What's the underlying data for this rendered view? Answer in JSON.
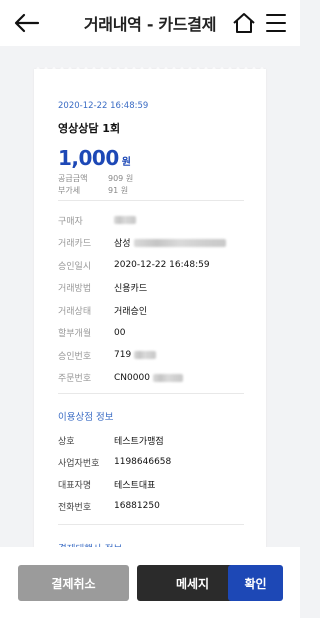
{
  "header": {
    "title": "거래내역 - 카드결제",
    "back_icon": "arrow-left-icon",
    "home_icon": "home-icon",
    "menu_icon": "hamburger-menu-icon"
  },
  "receipt": {
    "datetime": "2020-12-22 16:48:59",
    "product": "영상상담 1회",
    "amount": "1,000",
    "currency": "원",
    "supply_label": "공급금액",
    "supply_value": "909 원",
    "vat_label": "부가세",
    "vat_value": "91 원"
  },
  "details": [
    {
      "label": "구매자",
      "value": ""
    },
    {
      "label": "거래카드",
      "value": "삼성"
    },
    {
      "label": "승인일시",
      "value": "2020-12-22 16:48:59"
    },
    {
      "label": "거래방법",
      "value": "신용카드"
    },
    {
      "label": "거래상태",
      "value": "거래승인"
    },
    {
      "label": "할부개월",
      "value": "00"
    },
    {
      "label": "승인번호",
      "value": "719"
    },
    {
      "label": "주문번호",
      "value": "CN0000"
    }
  ],
  "merchant": {
    "title": "이용상점 정보",
    "rows": [
      {
        "label": "상호",
        "value": "테스트가맹점"
      },
      {
        "label": "사업자번호",
        "value": "1198646658"
      },
      {
        "label": "대표자명",
        "value": "테스트대표"
      },
      {
        "label": "전화번호",
        "value": "16881250"
      }
    ]
  },
  "next_section_title": "결제대행사 정보",
  "buttons": {
    "cancel": "결제취소",
    "message": "메세지",
    "confirm": "확인"
  },
  "colors": {
    "accent": "#1d48b6",
    "link": "#3b6cc4",
    "dark_button": "#2b2b2b",
    "gray_button": "#9b9b9b"
  }
}
